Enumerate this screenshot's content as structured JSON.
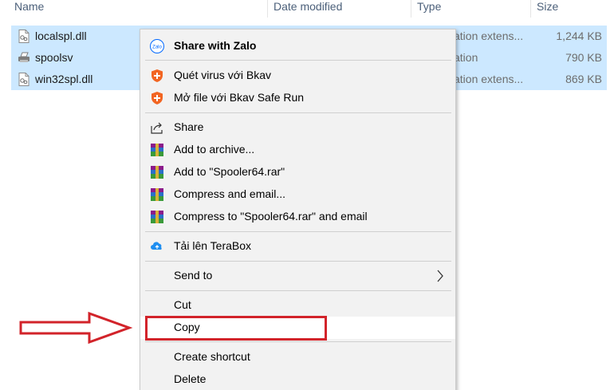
{
  "columns": {
    "name": "Name",
    "date_modified": "Date modified",
    "type": "Type",
    "size": "Size"
  },
  "files": [
    {
      "name": "localspl.dll",
      "type": "ation extens...",
      "size": "1,244 KB",
      "icon": "dll-file-icon"
    },
    {
      "name": "spoolsv",
      "type": "ation",
      "size": "790 KB",
      "icon": "printer-app-icon"
    },
    {
      "name": "win32spl.dll",
      "type": "ation extens...",
      "size": "869 KB",
      "icon": "dll-file-icon"
    }
  ],
  "menu": {
    "share_zalo": "Share with Zalo",
    "zalo_logo_text": "Zalo",
    "scan_bkav": "Quét virus với Bkav",
    "open_bkav": "Mở file với Bkav Safe Run",
    "share": "Share",
    "add_archive": "Add to archive...",
    "add_rar": "Add to \"Spooler64.rar\"",
    "compress_email": "Compress and email...",
    "compress_rar_email": "Compress to \"Spooler64.rar\" and email",
    "terabox": "Tải lên TeraBox",
    "send_to": "Send to",
    "cut": "Cut",
    "copy": "Copy",
    "create_shortcut": "Create shortcut",
    "delete": "Delete"
  },
  "colors": {
    "selection": "#cce8ff",
    "menu_bg": "#f2f2f2",
    "highlight_box": "#d2232a",
    "bkav_orange": "#f26522",
    "zalo_blue": "#0068ff"
  }
}
